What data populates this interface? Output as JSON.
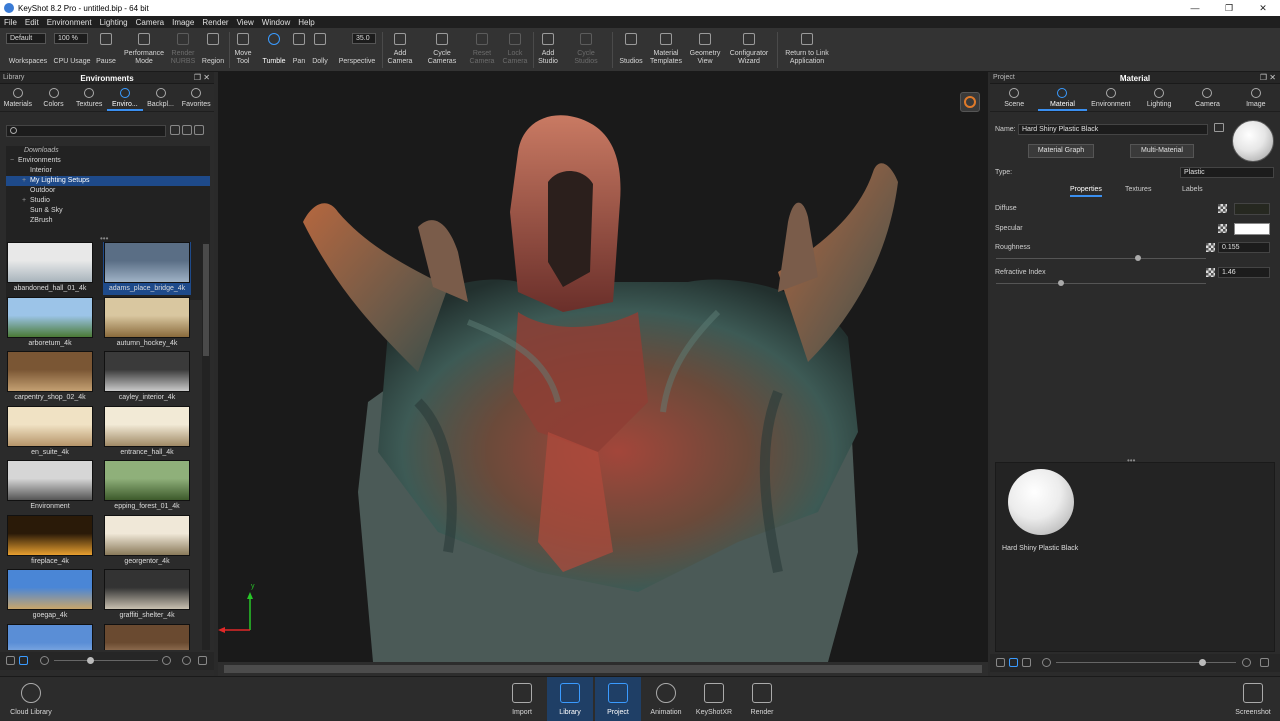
{
  "window": {
    "title": "KeyShot 8.2 Pro  - untitled.bip  - 64 bit",
    "controls": [
      "—",
      "❐",
      "✕"
    ]
  },
  "menu": [
    "File",
    "Edit",
    "Environment",
    "Lighting",
    "Camera",
    "Image",
    "Render",
    "View",
    "Window",
    "Help"
  ],
  "toolbar": {
    "workspace_value": "Default",
    "cpu_value": "100 %",
    "fov_value": "35.0",
    "buttons": {
      "workspaces": "Workspaces",
      "cpu": "CPU Usage",
      "pause": "Pause",
      "performance": "Performance Mode",
      "render_nurbs": "Render NURBS",
      "region": "Region",
      "move_tool": "Move Tool",
      "tumble": "Tumble",
      "pan": "Pan",
      "dolly": "Dolly",
      "perspective": "Perspective",
      "add_camera": "Add Camera",
      "cycle_cameras": "Cycle Cameras",
      "reset_camera": "Reset Camera",
      "lock_camera": "Lock Camera",
      "add_studio": "Add Studio",
      "cycle_studios": "Cycle Studios",
      "studios": "Studios",
      "material_templates": "Material Templates",
      "geometry_view": "Geometry View",
      "configurator": "Configurator Wizard",
      "return_link": "Return to Link Application"
    }
  },
  "library": {
    "panel_label": "Library",
    "title": "Environments",
    "tabs": [
      "Materials",
      "Colors",
      "Textures",
      "Enviro...",
      "Backpl...",
      "Favorites"
    ],
    "tree": [
      {
        "label": "Downloads",
        "indent": 1,
        "italic": true
      },
      {
        "label": "Environments",
        "indent": 0,
        "prefix": "−"
      },
      {
        "label": "Interior",
        "indent": 2
      },
      {
        "label": "My Lighting Setups",
        "indent": 2,
        "prefix": "+",
        "selected": true
      },
      {
        "label": "Outdoor",
        "indent": 2
      },
      {
        "label": "Studio",
        "indent": 2,
        "prefix": "+"
      },
      {
        "label": "Sun & Sky",
        "indent": 2
      },
      {
        "label": "ZBrush",
        "indent": 2
      }
    ],
    "thumbnails": [
      "abandoned_hall_01_4k",
      "adams_place_bridge_4k",
      "arboretum_4k",
      "autumn_hockey_4k",
      "carpentry_shop_02_4k",
      "cayley_interior_4k",
      "en_suite_4k",
      "entrance_hall_4k",
      "Environment",
      "epping_forest_01_4k",
      "fireplace_4k",
      "georgentor_4k",
      "goegap_4k",
      "graffiti_shelter_4k",
      "",
      ""
    ],
    "selected_thumbnail": "adams_place_bridge_4k"
  },
  "viewport": {
    "axis_x": "x",
    "axis_y": "y"
  },
  "project": {
    "panel_label": "Project",
    "title": "Material",
    "tabs": [
      "Scene",
      "Material",
      "Environment",
      "Lighting",
      "Camera",
      "Image"
    ],
    "name_label": "Name:",
    "name_value": "Hard Shiny Plastic Black",
    "material_graph_btn": "Material Graph",
    "multi_material_btn": "Multi-Material",
    "type_label": "Type:",
    "type_value": "Plastic",
    "subtabs": [
      "Properties",
      "Textures",
      "Labels"
    ],
    "properties": {
      "diffuse_label": "Diffuse",
      "specular_label": "Specular",
      "roughness_label": "Roughness",
      "roughness_value": "0.155",
      "refractive_label": "Refractive Index",
      "refractive_value": "1.46"
    },
    "preview_caption": "Hard Shiny Plastic Black"
  },
  "dock": {
    "cloud_library": "Cloud Library",
    "items": [
      "Import",
      "Library",
      "Project",
      "Animation",
      "KeyShotXR",
      "Render"
    ],
    "selected": [
      "Library",
      "Project"
    ],
    "screenshot": "Screenshot"
  },
  "colors": {
    "accent": "#3a8ff0",
    "selection": "#1e4a8a",
    "viewport_bg": "#1a1a1a"
  }
}
